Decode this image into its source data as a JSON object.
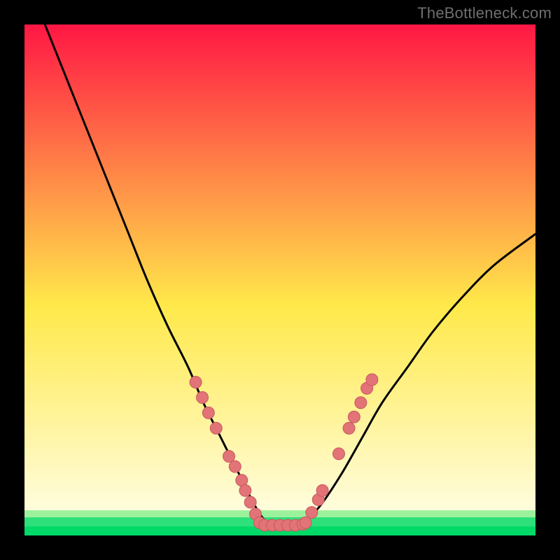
{
  "watermark": "TheBottleneck.com",
  "colors": {
    "frame": "#000000",
    "curve": "#000000",
    "marker_fill": "#e27377",
    "marker_stroke": "#c85a5e",
    "grad_top": "#ff1744",
    "grad_mid": "#ffe94a",
    "grad_bot": "#fffde0",
    "green1": "#9cf29c",
    "green2": "#2de07a",
    "green3": "#00d968"
  },
  "chart_data": {
    "type": "line",
    "title": "",
    "xlabel": "",
    "ylabel": "",
    "xlim": [
      0,
      100
    ],
    "ylim": [
      0,
      100
    ],
    "grid": false,
    "legend": false,
    "series": [
      {
        "name": "bottleneck-curve",
        "x": [
          4,
          8,
          12,
          16,
          20,
          24,
          28,
          32,
          35,
          38,
          41,
          43,
          45,
          47,
          49,
          52,
          55,
          58,
          62,
          66,
          70,
          75,
          80,
          86,
          92,
          100
        ],
        "y": [
          100,
          90,
          80,
          70,
          60,
          50,
          41,
          33,
          26,
          20,
          14,
          10,
          6,
          3,
          2,
          2,
          3,
          6,
          12,
          19,
          26,
          33,
          40,
          47,
          53,
          59
        ]
      }
    ],
    "markers": [
      {
        "x": 33.5,
        "y": 30.0
      },
      {
        "x": 34.8,
        "y": 27.0
      },
      {
        "x": 36.0,
        "y": 24.0
      },
      {
        "x": 37.5,
        "y": 21.0
      },
      {
        "x": 40.0,
        "y": 15.5
      },
      {
        "x": 41.2,
        "y": 13.5
      },
      {
        "x": 42.5,
        "y": 10.8
      },
      {
        "x": 43.2,
        "y": 8.8
      },
      {
        "x": 44.2,
        "y": 6.5
      },
      {
        "x": 45.2,
        "y": 4.2
      },
      {
        "x": 46.0,
        "y": 2.5
      },
      {
        "x": 47.0,
        "y": 2.0
      },
      {
        "x": 48.5,
        "y": 2.0
      },
      {
        "x": 50.0,
        "y": 2.0
      },
      {
        "x": 51.5,
        "y": 2.0
      },
      {
        "x": 53.0,
        "y": 2.0
      },
      {
        "x": 54.5,
        "y": 2.2
      },
      {
        "x": 55.0,
        "y": 2.5
      },
      {
        "x": 56.2,
        "y": 4.5
      },
      {
        "x": 57.5,
        "y": 7.0
      },
      {
        "x": 58.3,
        "y": 8.8
      },
      {
        "x": 61.5,
        "y": 16.0
      },
      {
        "x": 63.5,
        "y": 21.0
      },
      {
        "x": 64.5,
        "y": 23.2
      },
      {
        "x": 65.8,
        "y": 26.0
      },
      {
        "x": 67.0,
        "y": 28.8
      },
      {
        "x": 68.0,
        "y": 30.5
      }
    ],
    "green_bands": [
      {
        "y_from": 5.0,
        "y_to": 3.5,
        "color_key": "green1"
      },
      {
        "y_from": 3.5,
        "y_to": 1.8,
        "color_key": "green2"
      },
      {
        "y_from": 1.8,
        "y_to": 0.0,
        "color_key": "green3"
      }
    ]
  }
}
